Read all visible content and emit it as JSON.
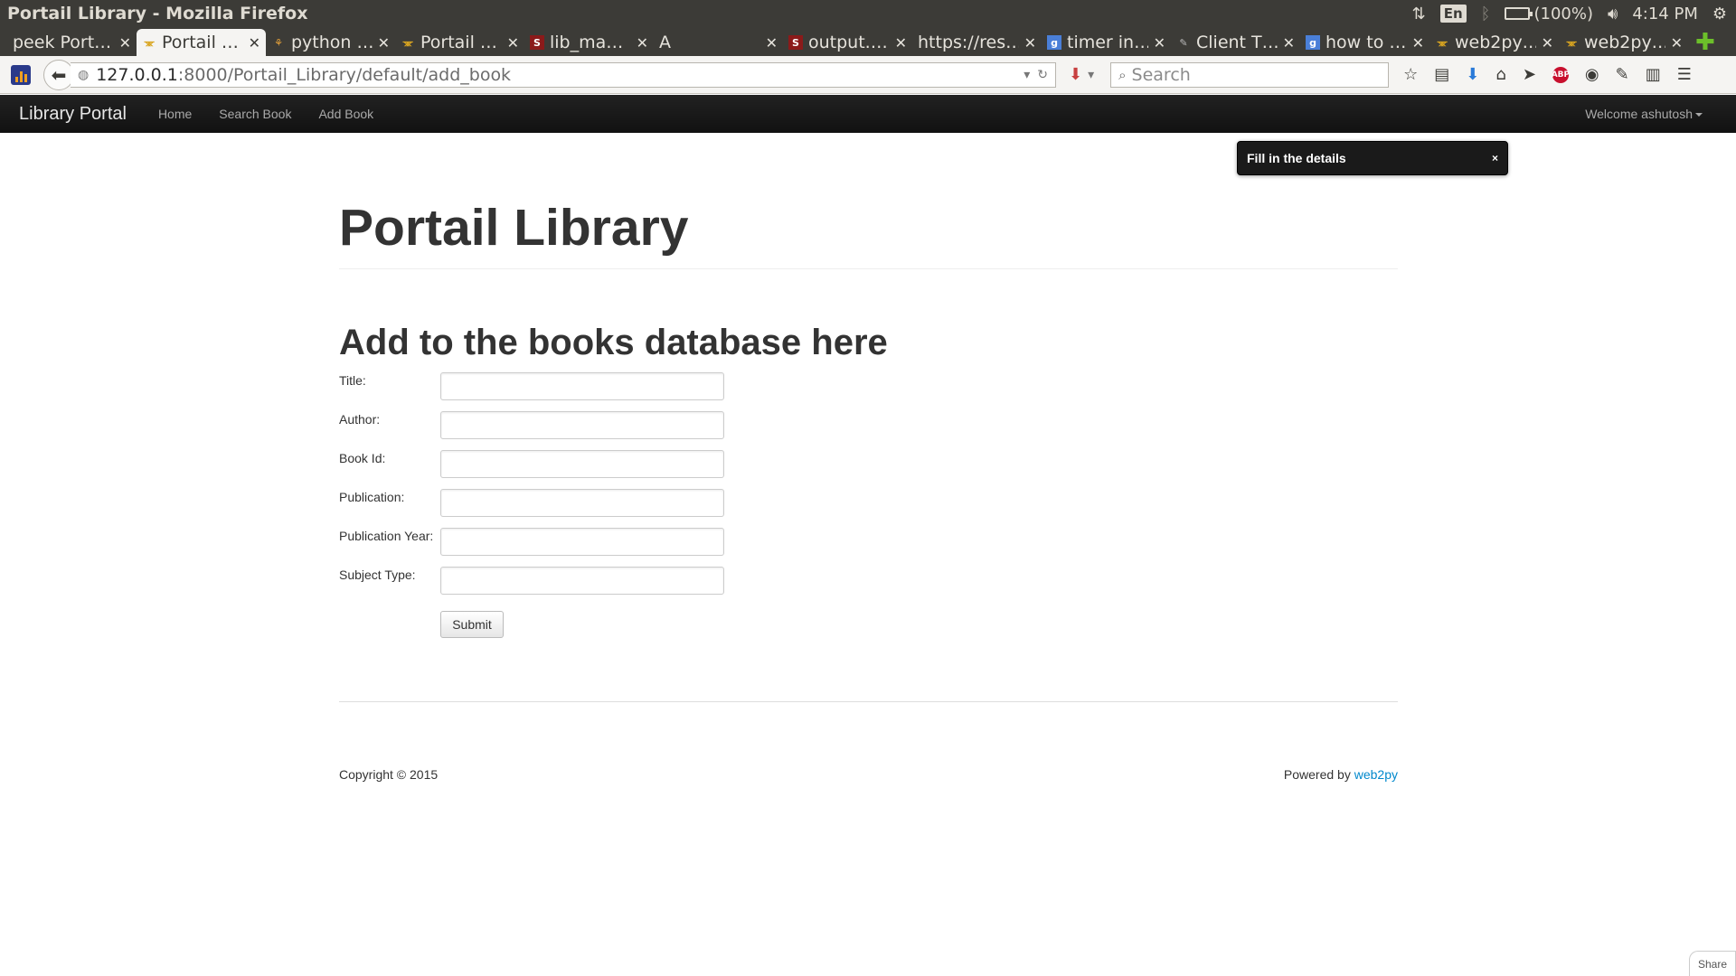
{
  "os": {
    "window_title": "Portail Library - Mozilla Firefox",
    "language": "En",
    "battery": "(100%)",
    "time": "4:14 PM"
  },
  "tabs": [
    {
      "label": "peek Port…",
      "icon": "none",
      "active": false
    },
    {
      "label": "Portail …",
      "icon": "web2py-icon",
      "active": true
    },
    {
      "label": "python …",
      "icon": "python-icon",
      "active": false
    },
    {
      "label": "Portail …",
      "icon": "web2py-icon",
      "active": false
    },
    {
      "label": "lib_ma…",
      "icon": "s-icon",
      "active": false
    },
    {
      "label": "A",
      "icon": "none",
      "active": false
    },
    {
      "label": "output.…",
      "icon": "s-icon",
      "active": false
    },
    {
      "label": "https://res…",
      "icon": "none",
      "active": false
    },
    {
      "label": "timer in…",
      "icon": "google-icon",
      "active": false
    },
    {
      "label": "Client T…",
      "icon": "client-icon",
      "active": false
    },
    {
      "label": "how to …",
      "icon": "google-icon",
      "active": false
    },
    {
      "label": "web2py…",
      "icon": "web2py-icon",
      "active": false
    },
    {
      "label": "web2py…",
      "icon": "web2py-icon",
      "active": false
    }
  ],
  "toolbar": {
    "url_host": "127.0.0.1",
    "url_path": ":8000/Portail_Library/default/add_book",
    "search_placeholder": "Search"
  },
  "site_nav": {
    "brand": "Library Portal",
    "links": [
      "Home",
      "Search Book",
      "Add Book"
    ],
    "welcome": "Welcome ashutosh"
  },
  "flash": {
    "message": "Fill in the details",
    "close": "×"
  },
  "main": {
    "title": "Portail Library",
    "subtitle": "Add to the books database here",
    "fields": [
      {
        "label": "Title:",
        "value": ""
      },
      {
        "label": "Author:",
        "value": ""
      },
      {
        "label": "Book Id:",
        "value": ""
      },
      {
        "label": "Publication:",
        "value": ""
      },
      {
        "label": "Publication Year:",
        "value": ""
      },
      {
        "label": "Subject Type:",
        "value": ""
      }
    ],
    "submit_label": "Submit"
  },
  "footer": {
    "copyright": "Copyright © 2015",
    "powered_by": "Powered by",
    "powered_link": "web2py"
  },
  "share_label": "Share",
  "colors": {
    "navbar": "#1b1b1b",
    "link": "#0088cc",
    "os_bar": "#3c3b37"
  }
}
